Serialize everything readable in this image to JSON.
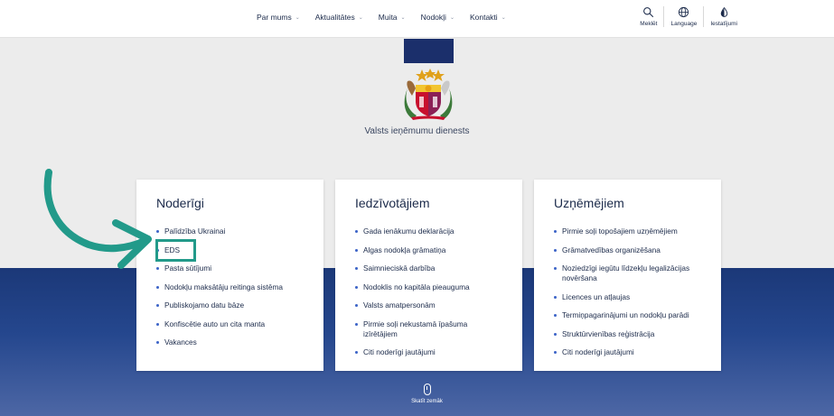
{
  "nav": {
    "items": [
      {
        "label": "Par mums"
      },
      {
        "label": "Aktualitātes"
      },
      {
        "label": "Muita"
      },
      {
        "label": "Nodokļi"
      },
      {
        "label": "Kontakti"
      }
    ],
    "chevron": "⌄"
  },
  "tools": {
    "search_label": "Meklēt",
    "language_label": "Language",
    "settings_label": "Iestatījumi"
  },
  "hero": {
    "agency_name": "Valsts ieņēmumu dienests"
  },
  "cards": [
    {
      "title": "Noderīgi",
      "items": [
        "Palīdzība Ukrainai",
        "EDS",
        "Pasta sūtījumi",
        "Nodokļu maksātāju reitinga sistēma",
        "Publiskojamo datu bāze",
        "Konfiscētie auto un cita manta",
        "Vakances"
      ]
    },
    {
      "title": "Iedzīvotājiem",
      "items": [
        "Gada ienākumu deklarācija",
        "Algas nodokļa grāmatiņa",
        "Saimnieciskā darbība",
        "Nodoklis no kapitāla pieauguma",
        "Valsts amatpersonām",
        "Pirmie soļi nekustamā īpašuma izīrētājiem",
        "Citi noderīgi jautājumi"
      ]
    },
    {
      "title": "Uzņēmējiem",
      "items": [
        "Pirmie soļi topošajiem uzņēmējiem",
        "Grāmatvedības organizēšana",
        "Noziedzīgi iegūtu līdzekļu legalizācijas novēršana",
        "Licences un atļaujas",
        "Termiņpagarinājumi un nodokļu parādi",
        "Struktūrvienības reģistrācija",
        "Citi noderīgi jautājumi"
      ]
    }
  ],
  "scroll": {
    "label": "Skatīt zemāk"
  },
  "colors": {
    "accent": "#229a8a",
    "navy": "#1b2f6b",
    "bullet": "#3c63c7"
  }
}
